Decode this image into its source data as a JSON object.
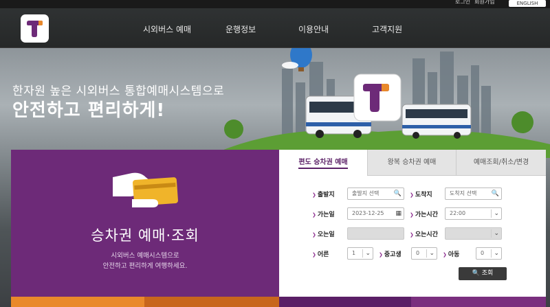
{
  "topbar": {
    "util_a": "로그인",
    "util_b": "회원가입",
    "lang_button": "ENGLISH"
  },
  "header": {
    "nav": [
      "시외버스 예매",
      "운행정보",
      "이용안내",
      "고객지원"
    ]
  },
  "hero": {
    "subtitle": "한자원 높은 시외버스 통합예매시스템으로",
    "title": "안전하고 편리하게!"
  },
  "ticket_panel": {
    "title": "승차권 예매·조회",
    "desc_line1": "시외버스 예매시스템으로",
    "desc_line2": "안전하고 편리하게 여행하세요."
  },
  "form": {
    "tabs": [
      "편도 승차권 예매",
      "왕복 승차권 예매",
      "예매조회/취소/변경"
    ],
    "labels": {
      "departure": "출발지",
      "arrival": "도착지",
      "go_date": "가는일",
      "go_time": "가는시간",
      "return_date": "오는일",
      "return_time": "오는시간",
      "adult": "어른",
      "student": "중고생",
      "child": "아동"
    },
    "departure_placeholder": "출발지 선택",
    "arrival_placeholder": "도착지 선택",
    "go_date_value": "2023-12-25",
    "go_time_value": "22:00",
    "adult_count": "1",
    "student_count": "0",
    "child_count": "0",
    "search_button": "조회"
  },
  "colors": {
    "brand_purple": "#6d2a78",
    "accent_orange": "#e9892b"
  }
}
